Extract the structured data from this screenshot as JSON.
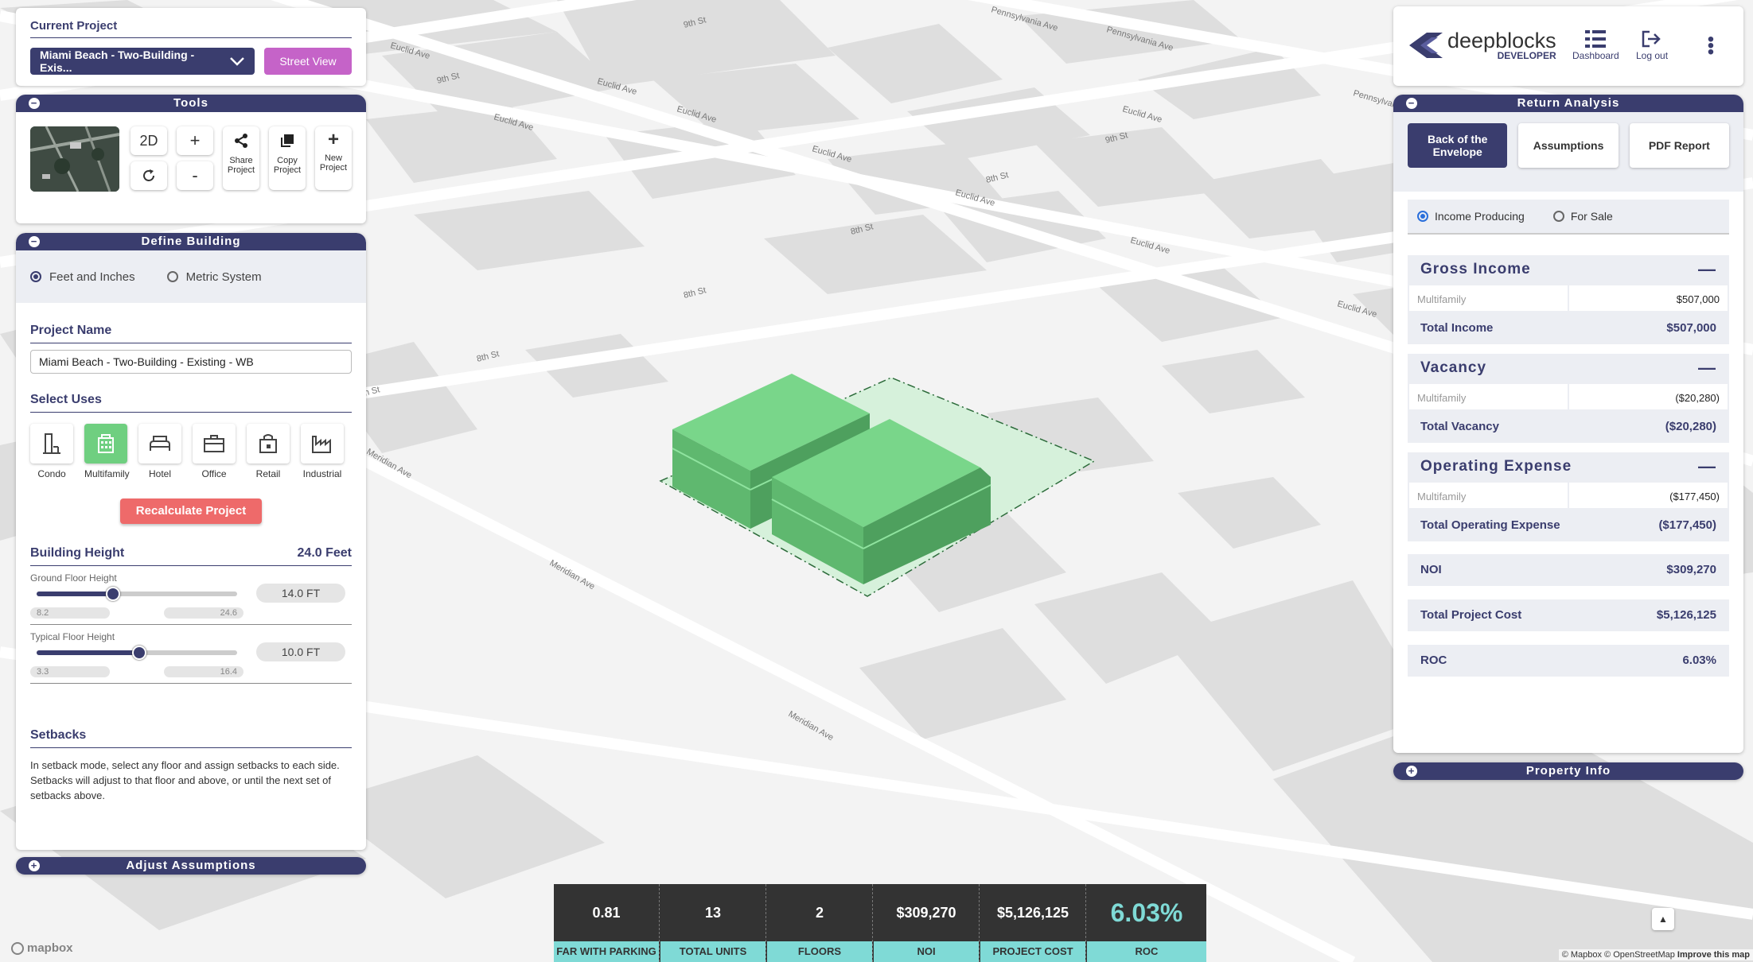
{
  "map": {
    "streets": [
      "Euclid Ave",
      "Euclid Ave",
      "Euclid Ave",
      "Euclid Ave",
      "Euclid Ave",
      "Euclid Ave",
      "Euclid Ave",
      "Euclid Ave",
      "Euclid Ave",
      "9th St",
      "9th St",
      "9th St",
      "8th St",
      "8th St",
      "8th St",
      "8th St",
      "8th St",
      "Pennsylvania Ave",
      "Pennsylvania Ave",
      "Pennsylvania Ave",
      "Meridian Ave",
      "Meridian Ave",
      "Meridian Ave"
    ],
    "attribution": "© Mapbox © OpenStreetMap",
    "improve": "Improve this map",
    "logo": "mapbox"
  },
  "current_project": {
    "title": "Current Project",
    "selected": "Miami Beach - Two-Building - Exis...",
    "street_view": "Street View"
  },
  "tools": {
    "title": "Tools",
    "btn_2d": "2D",
    "zoom_in": "+",
    "zoom_out": "-",
    "share": [
      "Share",
      "Project"
    ],
    "copy": [
      "Copy",
      "Project"
    ],
    "new": [
      "New",
      "Project"
    ]
  },
  "define_building": {
    "title": "Define Building",
    "unit_feet": "Feet and Inches",
    "unit_metric": "Metric System",
    "project_name_label": "Project Name",
    "project_name_value": "Miami Beach - Two-Building - Existing - WB",
    "select_uses_label": "Select Uses",
    "uses": [
      "Condo",
      "Multifamily",
      "Hotel",
      "Office",
      "Retail",
      "Industrial"
    ],
    "recalculate": "Recalculate Project",
    "building_height_label": "Building Height",
    "building_height_value": "24.0 Feet",
    "ground_label": "Ground Floor Height",
    "ground_value": "14.0 FT",
    "ground_min": "8.2",
    "ground_max": "24.6",
    "ground_level": 0.38,
    "typical_label": "Typical Floor Height",
    "typical_value": "10.0 FT",
    "typical_min": "3.3",
    "typical_max": "16.4",
    "typical_level": 0.51,
    "setbacks_label": "Setbacks",
    "setbacks_text": "In setback mode, select any floor and assign setbacks to each side. Setbacks will adjust to that floor and above, or until the next set of setbacks above."
  },
  "adjust_assumptions": {
    "title": "Adjust Assumptions"
  },
  "header": {
    "brand": "deepblocks",
    "brand_sub": "DEVELOPER",
    "dashboard": "Dashboard",
    "logout": "Log out"
  },
  "return_analysis": {
    "title": "Return Analysis",
    "tabs": [
      "Back of the Envelope",
      "Assumptions",
      "PDF Report"
    ],
    "mode_income": "Income Producing",
    "mode_sale": "For Sale",
    "gross_income": {
      "title": "Gross Income",
      "line_label": "Multifamily",
      "line_value": "$507,000",
      "total_label": "Total Income",
      "total_value": "$507,000"
    },
    "vacancy": {
      "title": "Vacancy",
      "line_label": "Multifamily",
      "line_value": "($20,280)",
      "total_label": "Total Vacancy",
      "total_value": "($20,280)"
    },
    "opex": {
      "title": "Operating Expense",
      "line_label": "Multifamily",
      "line_value": "($177,450)",
      "total_label": "Total Operating Expense",
      "total_value": "($177,450)"
    },
    "noi": {
      "label": "NOI",
      "value": "$309,270"
    },
    "cost": {
      "label": "Total Project Cost",
      "value": "$5,126,125"
    },
    "roc": {
      "label": "ROC",
      "value": "6.03%"
    }
  },
  "property_info": {
    "title": "Property Info"
  },
  "stats": [
    {
      "value": "0.81",
      "label": "FAR WITH PARKING"
    },
    {
      "value": "13",
      "label": "TOTAL UNITS"
    },
    {
      "value": "2",
      "label": "FLOORS"
    },
    {
      "value": "$309,270",
      "label": "NOI"
    },
    {
      "value": "$5,126,125",
      "label": "PROJECT COST"
    },
    {
      "value": "6.03%",
      "label": "ROC"
    }
  ],
  "colors": {
    "navy": "#3a3d6e",
    "accent": "#c563c8",
    "recalc": "#ee6a6a",
    "green": "#6fcf80",
    "teal": "#7fdad6"
  }
}
